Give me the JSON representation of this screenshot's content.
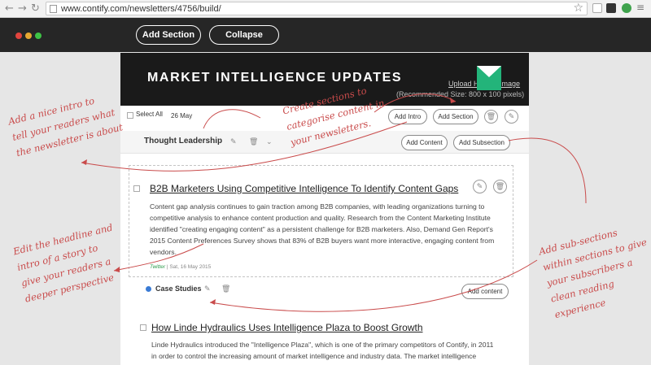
{
  "browser": {
    "back_icon": "←",
    "forward_icon": "→",
    "reload_icon": "↻",
    "url": "www.contify.com/newsletters/4756/build/",
    "star_icon": "☆"
  },
  "header": {
    "add_section_label": "Add Section",
    "collapse_label": "Collapse",
    "dot_colors": [
      "#e0443e",
      "#e6a732",
      "#3ec245"
    ]
  },
  "banner": {
    "title": "MARKET INTELLIGENCE UPDATES",
    "upload_label": "Upload Header Image",
    "recommended_size": "(Recommended Size: 800 x 100 pixels)"
  },
  "toolbar": {
    "select_all": "Select All",
    "date": "26 May",
    "add_intro": "Add Intro",
    "add_section": "Add Section"
  },
  "section": {
    "title": "Thought Leadership",
    "add_content": "Add Content",
    "add_subsection": "Add Subsection"
  },
  "story1": {
    "headline": "B2B Marketers Using Competitive Intelligence To Identify Content Gaps",
    "body_lines": [
      "Content gap analysis continues to gain traction among B2B companies, with leading organizations turning to",
      "competitive analysis to enhance content production and quality. Research from the Content Marketing Institute",
      "identified \"creating engaging content\" as a persistent challenge for B2B marketers. Also, Demand Gen Report's",
      "2015 Content Preferences Survey shows that 83% of B2B buyers want more interactive, engaging content from",
      "vendors."
    ],
    "source": "Twitter",
    "date": "| Sat, 16 May 2015"
  },
  "subsection": {
    "title": "Case Studies",
    "add_content": "Add content"
  },
  "story2": {
    "headline": "How Linde Hydraulics Uses Intelligence Plaza to Boost Growth",
    "body_lines": [
      "Linde Hydraulics introduced the \"Intelligence Plaza\", which is one of the primary competitors of Contify, in 2011",
      "in order to control the increasing amount of market intelligence and industry data. The market intelligence"
    ]
  },
  "annotations": {
    "intro": [
      "Add a nice intro to",
      "tell your readers what",
      "the newsletter is about"
    ],
    "sections": [
      "Create sections to",
      "categorise content in",
      "your newsletters."
    ],
    "headline": [
      "Edit the headline and",
      "intro of a story to",
      "give your readers a",
      "deeper perspective"
    ],
    "subsections": [
      "Add sub-sections",
      "within sections to give",
      "your subscribers a",
      "clean reading",
      "experience"
    ]
  },
  "colors": {
    "annotation": "#c94b4b",
    "banner": "#1a1a1a",
    "header": "#262626"
  }
}
